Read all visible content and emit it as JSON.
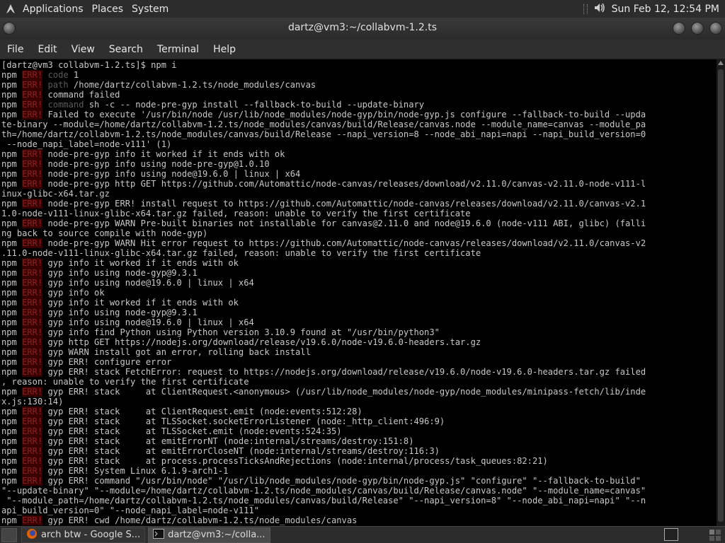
{
  "top_panel": {
    "menus": [
      "Applications",
      "Places",
      "System"
    ],
    "clock": "Sun Feb 12, 12:54 PM"
  },
  "window": {
    "title": "dartz@vm3:~/collabvm-1.2.ts"
  },
  "menubar": [
    "File",
    "Edit",
    "View",
    "Search",
    "Terminal",
    "Help"
  ],
  "terminal": {
    "lines": [
      {
        "t": "plain",
        "text": "[dartz@vm3 collabvm-1.2.ts]$ npm i"
      },
      {
        "t": "err",
        "tag": "ERR!",
        "text": " code 1",
        "kwdim": "code"
      },
      {
        "t": "err",
        "tag": "ERR!",
        "text": " path /home/dartz/collabvm-1.2.ts/node_modules/canvas",
        "kwdim": "path"
      },
      {
        "t": "err",
        "tag": "ERR!",
        "text": " command failed"
      },
      {
        "t": "err",
        "tag": "ERR!",
        "text": " command sh -c -- node-pre-gyp install --fallback-to-build --update-binary",
        "kwdim": "command"
      },
      {
        "t": "err",
        "tag": "ERR!",
        "text": " Failed to execute '/usr/bin/node /usr/lib/node_modules/node-gyp/bin/node-gyp.js configure --fallback-to-build --upda"
      },
      {
        "t": "plain",
        "text": "te-binary --module=/home/dartz/collabvm-1.2.ts/node_modules/canvas/build/Release/canvas.node --module_name=canvas --module_pa"
      },
      {
        "t": "plain",
        "text": "th=/home/dartz/collabvm-1.2.ts/node_modules/canvas/build/Release --napi_version=8 --node_abi_napi=napi --napi_build_version=0"
      },
      {
        "t": "plain",
        "text": " --node_napi_label=node-v111' (1)"
      },
      {
        "t": "err",
        "tag": "ERR!",
        "text": " node-pre-gyp info it worked if it ends with ok"
      },
      {
        "t": "err",
        "tag": "ERR!",
        "text": " node-pre-gyp info using node-pre-gyp@1.0.10"
      },
      {
        "t": "err",
        "tag": "ERR!",
        "text": " node-pre-gyp info using node@19.6.0 | linux | x64"
      },
      {
        "t": "err",
        "tag": "ERR!",
        "text": " node-pre-gyp http GET https://github.com/Automattic/node-canvas/releases/download/v2.11.0/canvas-v2.11.0-node-v111-l"
      },
      {
        "t": "plain",
        "text": "inux-glibc-x64.tar.gz"
      },
      {
        "t": "err",
        "tag": "ERR!",
        "text": " node-pre-gyp ERR! install request to https://github.com/Automattic/node-canvas/releases/download/v2.11.0/canvas-v2.1"
      },
      {
        "t": "plain",
        "text": "1.0-node-v111-linux-glibc-x64.tar.gz failed, reason: unable to verify the first certificate"
      },
      {
        "t": "err",
        "tag": "ERR!",
        "text": " node-pre-gyp WARN Pre-built binaries not installable for canvas@2.11.0 and node@19.6.0 (node-v111 ABI, glibc) (falli"
      },
      {
        "t": "plain",
        "text": "ng back to source compile with node-gyp)"
      },
      {
        "t": "err",
        "tag": "ERR!",
        "text": " node-pre-gyp WARN Hit error request to https://github.com/Automattic/node-canvas/releases/download/v2.11.0/canvas-v2"
      },
      {
        "t": "plain",
        "text": ".11.0-node-v111-linux-glibc-x64.tar.gz failed, reason: unable to verify the first certificate"
      },
      {
        "t": "err",
        "tag": "ERR!",
        "text": " gyp info it worked if it ends with ok"
      },
      {
        "t": "err",
        "tag": "ERR!",
        "text": " gyp info using node-gyp@9.3.1"
      },
      {
        "t": "err",
        "tag": "ERR!",
        "text": " gyp info using node@19.6.0 | linux | x64"
      },
      {
        "t": "err",
        "tag": "ERR!",
        "text": " gyp info ok"
      },
      {
        "t": "err",
        "tag": "ERR!",
        "text": " gyp info it worked if it ends with ok"
      },
      {
        "t": "err",
        "tag": "ERR!",
        "text": " gyp info using node-gyp@9.3.1"
      },
      {
        "t": "err",
        "tag": "ERR!",
        "text": " gyp info using node@19.6.0 | linux | x64"
      },
      {
        "t": "err",
        "tag": "ERR!",
        "text": " gyp info find Python using Python version 3.10.9 found at \"/usr/bin/python3\""
      },
      {
        "t": "err",
        "tag": "ERR!",
        "text": " gyp http GET https://nodejs.org/download/release/v19.6.0/node-v19.6.0-headers.tar.gz"
      },
      {
        "t": "err",
        "tag": "ERR!",
        "text": " gyp WARN install got an error, rolling back install"
      },
      {
        "t": "err",
        "tag": "ERR!",
        "text": " gyp ERR! configure error"
      },
      {
        "t": "err",
        "tag": "ERR!",
        "text": " gyp ERR! stack FetchError: request to https://nodejs.org/download/release/v19.6.0/node-v19.6.0-headers.tar.gz failed"
      },
      {
        "t": "plain",
        "text": ", reason: unable to verify the first certificate"
      },
      {
        "t": "err",
        "tag": "ERR!",
        "text": " gyp ERR! stack     at ClientRequest.<anonymous> (/usr/lib/node_modules/node-gyp/node_modules/minipass-fetch/lib/inde"
      },
      {
        "t": "plain",
        "text": "x.js:130:14)"
      },
      {
        "t": "err",
        "tag": "ERR!",
        "text": " gyp ERR! stack     at ClientRequest.emit (node:events:512:28)"
      },
      {
        "t": "err",
        "tag": "ERR!",
        "text": " gyp ERR! stack     at TLSSocket.socketErrorListener (node:_http_client:496:9)"
      },
      {
        "t": "err",
        "tag": "ERR!",
        "text": " gyp ERR! stack     at TLSSocket.emit (node:events:524:35)"
      },
      {
        "t": "err",
        "tag": "ERR!",
        "text": " gyp ERR! stack     at emitErrorNT (node:internal/streams/destroy:151:8)"
      },
      {
        "t": "err",
        "tag": "ERR!",
        "text": " gyp ERR! stack     at emitErrorCloseNT (node:internal/streams/destroy:116:3)"
      },
      {
        "t": "err",
        "tag": "ERR!",
        "text": " gyp ERR! stack     at process.processTicksAndRejections (node:internal/process/task_queues:82:21)"
      },
      {
        "t": "err",
        "tag": "ERR!",
        "text": " gyp ERR! System Linux 6.1.9-arch1-1"
      },
      {
        "t": "err",
        "tag": "ERR!",
        "text": " gyp ERR! command \"/usr/bin/node\" \"/usr/lib/node_modules/node-gyp/bin/node-gyp.js\" \"configure\" \"--fallback-to-build\""
      },
      {
        "t": "plain",
        "text": "\"--update-binary\" \"--module=/home/dartz/collabvm-1.2.ts/node_modules/canvas/build/Release/canvas.node\" \"--module_name=canvas\""
      },
      {
        "t": "plain",
        "text": " \"--module_path=/home/dartz/collabvm-1.2.ts/node_modules/canvas/build/Release\" \"--napi_version=8\" \"--node_abi_napi=napi\" \"--n"
      },
      {
        "t": "plain",
        "text": "api_build_version=0\" \"--node_napi_label=node-v111\""
      },
      {
        "t": "err",
        "tag": "ERR!",
        "text": " gyp ERR! cwd /home/dartz/collabvm-1.2.ts/node_modules/canvas"
      }
    ]
  },
  "taskbar": {
    "tasks": [
      {
        "label": "arch btw - Google S...",
        "icon": "firefox-icon"
      },
      {
        "label": "dartz@vm3:~/colla...",
        "icon": "terminal-icon"
      }
    ]
  },
  "colors": {
    "panel_bg": "#2c2c2c",
    "terminal_bg": "#000000",
    "terminal_fg": "#c8c8c8",
    "err_tag_fg": "#8a2020",
    "err_tag_bg": "#3a0000"
  }
}
